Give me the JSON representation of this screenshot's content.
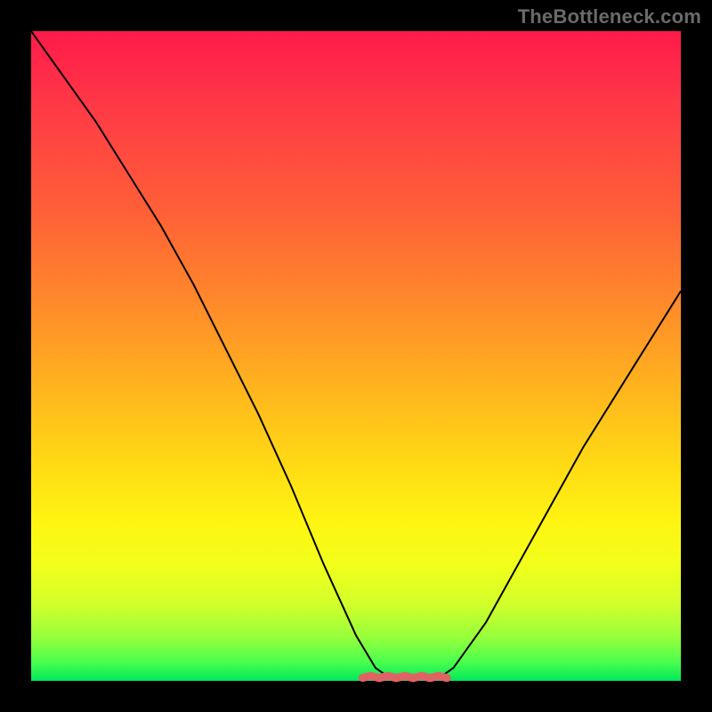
{
  "watermark": "TheBottleneck.com",
  "colors": {
    "frame": "#000000",
    "marker": "#de6464",
    "marker_dark": "#c94f4f",
    "gradient_top": "#ff1a4a",
    "gradient_bottom": "#00e85c"
  },
  "chart_data": {
    "type": "line",
    "title": "",
    "xlabel": "",
    "ylabel": "",
    "xlim": [
      0,
      100
    ],
    "ylim": [
      0,
      100
    ],
    "grid": false,
    "x": [
      0,
      5,
      10,
      15,
      20,
      25,
      30,
      35,
      40,
      45,
      50,
      53,
      55,
      58,
      61,
      63,
      65,
      70,
      75,
      80,
      85,
      90,
      95,
      100
    ],
    "values": [
      100,
      93,
      86,
      78,
      70,
      61,
      51,
      41,
      30,
      18,
      7,
      2,
      0.6,
      0.2,
      0.2,
      0.6,
      2,
      9,
      18,
      27,
      36,
      44,
      52,
      60
    ],
    "highlight_range_x": [
      51,
      64
    ],
    "highlight_range_y": 0.6,
    "annotations": []
  }
}
